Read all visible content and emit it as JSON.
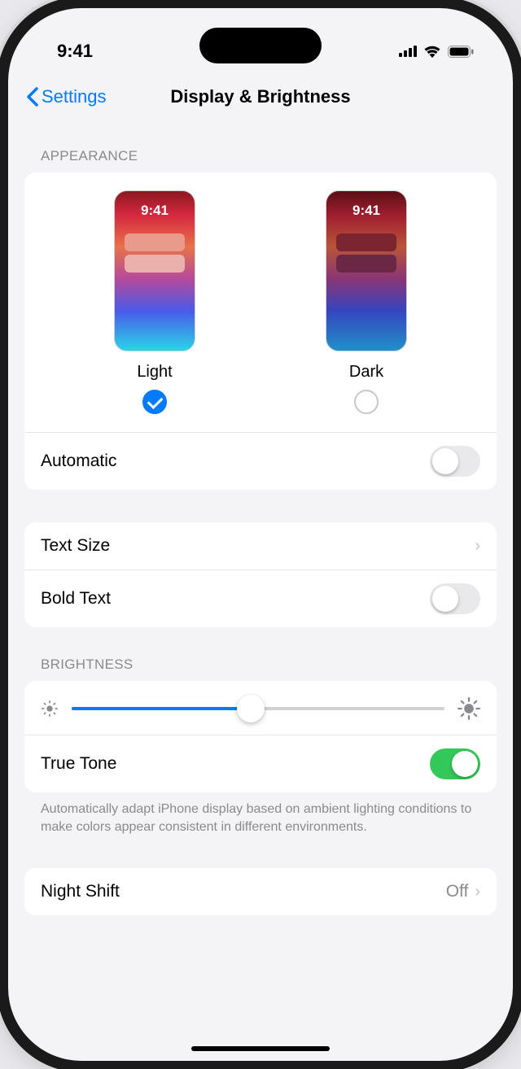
{
  "status": {
    "time": "9:41"
  },
  "nav": {
    "back": "Settings",
    "title": "Display & Brightness"
  },
  "appearance": {
    "header": "Appearance",
    "preview_time": "9:41",
    "light_label": "Light",
    "dark_label": "Dark",
    "selected": "light",
    "automatic_label": "Automatic",
    "automatic_on": false
  },
  "text": {
    "text_size_label": "Text Size",
    "bold_text_label": "Bold Text",
    "bold_text_on": false
  },
  "brightness": {
    "header": "Brightness",
    "value_pct": 48,
    "true_tone_label": "True Tone",
    "true_tone_on": true,
    "true_tone_desc": "Automatically adapt iPhone display based on ambient lighting conditions to make colors appear consistent in different environments."
  },
  "night_shift": {
    "label": "Night Shift",
    "value": "Off"
  }
}
